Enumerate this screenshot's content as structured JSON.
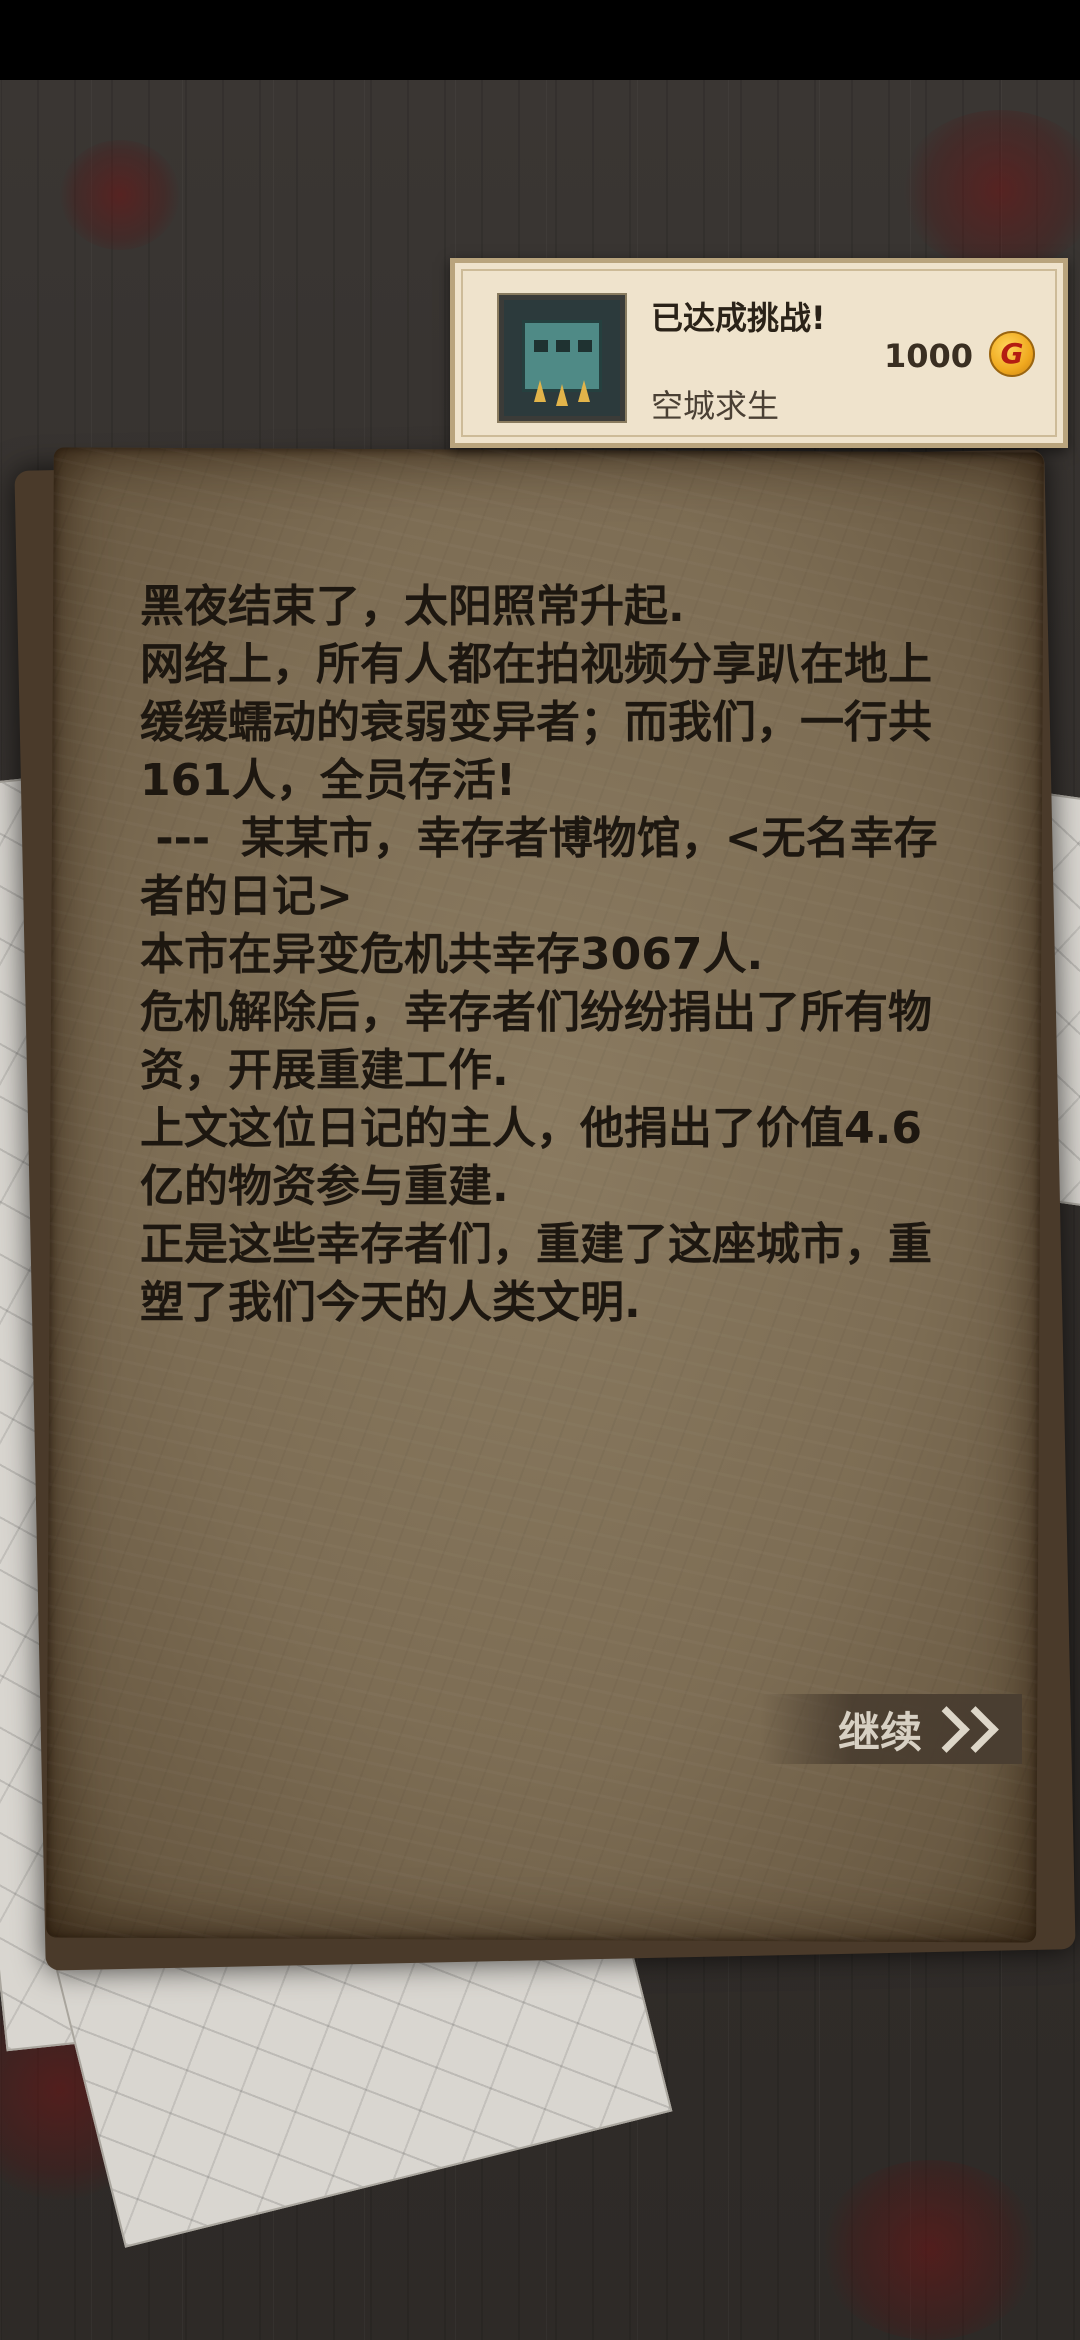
{
  "toast": {
    "title": "已达成挑战!",
    "name": "空城求生",
    "amount": "1000",
    "coin_symbol": "G",
    "icon": "city-fortress-badge-icon"
  },
  "story": {
    "lines": [
      "黑夜结束了，太阳照常升起.",
      "网络上，所有人都在拍视频分享趴在地上缓缓蠕动的衰弱变异者；而我们，一行共161人，全员存活!",
      " ---  某某市，幸存者博物馆，<无名幸存者的日记>",
      "本市在异变危机共幸存3067人.",
      "危机解除后，幸存者们纷纷捐出了所有物资，开展重建工作.",
      "上文这位日记的主人，他捐出了价值4.6亿的物资参与重建.",
      "正是这些幸存者们，重建了这座城市，重塑了我们今天的人类文明."
    ]
  },
  "continue_button": {
    "label": "继续",
    "icon": "double-chevron-right-icon"
  },
  "colors": {
    "paper": "#7d6d54",
    "text": "#1d1710",
    "toast_bg": "#efe3cc",
    "coin": "#f0a91f"
  }
}
